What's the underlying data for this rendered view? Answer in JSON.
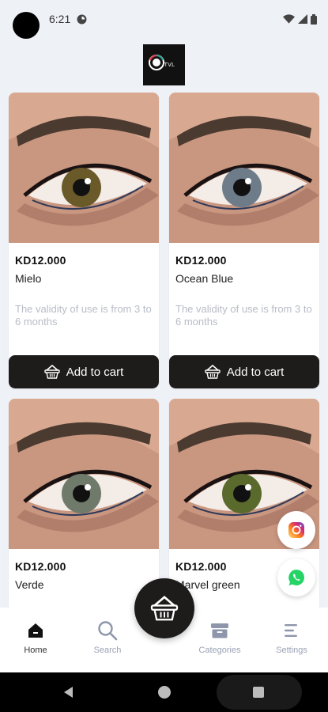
{
  "status_bar": {
    "time": "6:21"
  },
  "logo": {
    "text": "TVL"
  },
  "products": [
    {
      "price": "KD12.000",
      "name": "Mielo",
      "description": "The validity of use is from 3 to 6 months",
      "cart_label": "Add to cart",
      "iris_color": "#6a5a2a"
    },
    {
      "price": "KD12.000",
      "name": "Ocean Blue",
      "description": "The validity of use is from 3 to 6 months",
      "cart_label": "Add to cart",
      "iris_color": "#6e7c8a"
    },
    {
      "price": "KD12.000",
      "name": "Verde",
      "iris_color": "#6f7a6a"
    },
    {
      "price": "KD12.000",
      "name": "Marvel green",
      "iris_color": "#5a6a2c"
    }
  ],
  "bottom_nav": {
    "home": "Home",
    "search": "Search",
    "categories": "Categories",
    "settings": "Settings"
  },
  "icons": {
    "instagram": "instagram-icon",
    "whatsapp": "whatsapp-icon",
    "basket": "basket-icon"
  },
  "colors": {
    "background": "#eef1f6",
    "button_dark": "#1e1b1b",
    "muted_text": "#b8bcc6",
    "instagram": "#dd2a7b",
    "whatsapp": "#25d366"
  }
}
